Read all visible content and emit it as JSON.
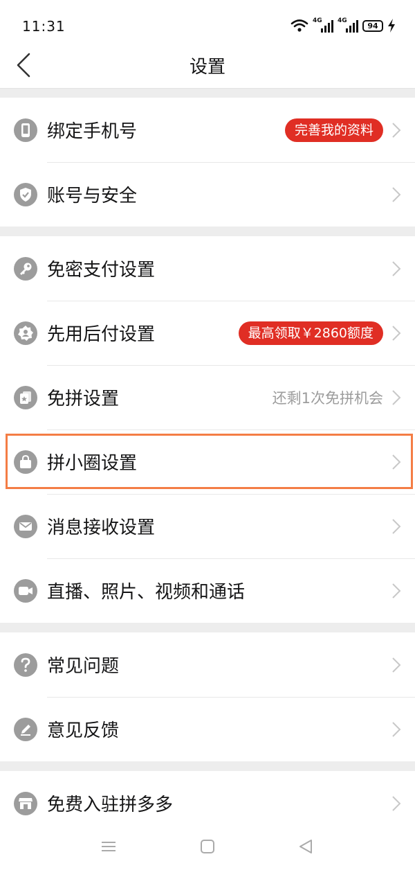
{
  "status": {
    "time": "11:31",
    "network_1": "4G",
    "network_2": "4G",
    "battery": "94"
  },
  "header": {
    "title": "设置"
  },
  "groups": [
    {
      "items": [
        {
          "label": "绑定手机号",
          "icon": "phone-icon",
          "badge": "完善我的资料"
        },
        {
          "label": "账号与安全",
          "icon": "shield-check-icon"
        }
      ]
    },
    {
      "items": [
        {
          "label": "免密支付设置",
          "icon": "key-icon"
        },
        {
          "label": "先用后付设置",
          "icon": "badge-person-icon",
          "badge": "最高领取￥2860额度"
        },
        {
          "label": "免拼设置",
          "icon": "card-star-icon",
          "hint": "还剩1次免拼机会"
        },
        {
          "label": "拼小圈设置",
          "icon": "bag-icon"
        },
        {
          "label": "消息接收设置",
          "icon": "envelope-icon"
        },
        {
          "label": "直播、照片、视频和通话",
          "icon": "video-camera-icon"
        }
      ]
    },
    {
      "items": [
        {
          "label": "常见问题",
          "icon": "question-icon"
        },
        {
          "label": "意见反馈",
          "icon": "pencil-icon"
        }
      ]
    },
    {
      "items": [
        {
          "label": "免费入驻拼多多",
          "icon": "store-icon"
        }
      ]
    }
  ],
  "colors": {
    "accent_red": "#e02e24",
    "highlight": "#f47d45",
    "icon_gray": "#9c9c9c"
  }
}
